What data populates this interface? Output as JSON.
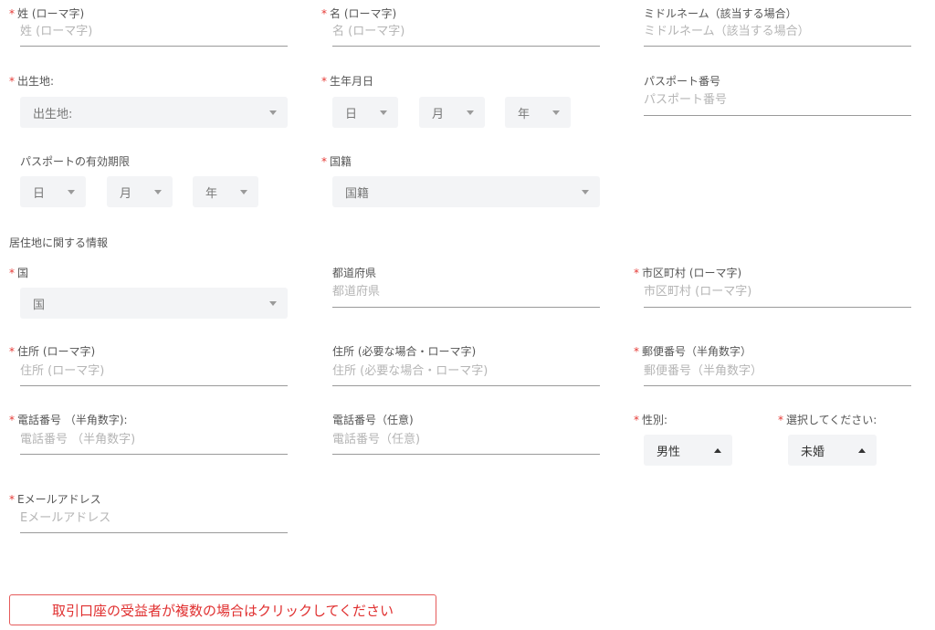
{
  "required_mark": "*",
  "fields": {
    "last_name": {
      "label": "姓 (ローマ字)",
      "placeholder": "姓 (ローマ字)"
    },
    "first_name": {
      "label": "名 (ローマ字)",
      "placeholder": "名 (ローマ字)"
    },
    "middle_name": {
      "label": "ミドルネーム（該当する場合）",
      "placeholder": "ミドルネーム（該当する場合）"
    },
    "birthplace": {
      "label": "出生地:",
      "value": "出生地:"
    },
    "birthdate": {
      "label": "生年月日",
      "day": "日",
      "month": "月",
      "year": "年"
    },
    "passport_number": {
      "label": "パスポート番号",
      "placeholder": "パスポート番号"
    },
    "passport_expiry": {
      "label": "パスポートの有効期限",
      "day": "日",
      "month": "月",
      "year": "年"
    },
    "nationality": {
      "label": "国籍",
      "value": "国籍"
    }
  },
  "residence": {
    "section_title": "居住地に関する情報",
    "country": {
      "label": "国",
      "value": "国"
    },
    "prefecture": {
      "label": "都道府県",
      "placeholder": "都道府県"
    },
    "city": {
      "label": "市区町村 (ローマ字)",
      "placeholder": "市区町村 (ローマ字)"
    },
    "address1": {
      "label": "住所 (ローマ字)",
      "placeholder": "住所 (ローマ字)"
    },
    "address2": {
      "label": "住所 (必要な場合・ローマ字)",
      "placeholder": "住所 (必要な場合・ローマ字)"
    },
    "postal_code": {
      "label": "郵便番号（半角数字）",
      "placeholder": "郵便番号（半角数字）"
    },
    "phone": {
      "label": "電話番号 （半角数字):",
      "placeholder": "電話番号 （半角数字)"
    },
    "phone_optional": {
      "label": "電話番号（任意)",
      "placeholder": "電話番号（任意)"
    },
    "gender": {
      "label": "性別:",
      "value": "男性"
    },
    "marital": {
      "label": "選択してください:",
      "value": "未婚"
    },
    "email": {
      "label": "Eメールアドレス",
      "placeholder": "Eメールアドレス"
    }
  },
  "cta": {
    "label": "取引口座の受益者が複数の場合はクリックしてください"
  },
  "colors": {
    "required": "#e53935",
    "cta": "#e03030",
    "select_bg": "#f3f4f6"
  }
}
